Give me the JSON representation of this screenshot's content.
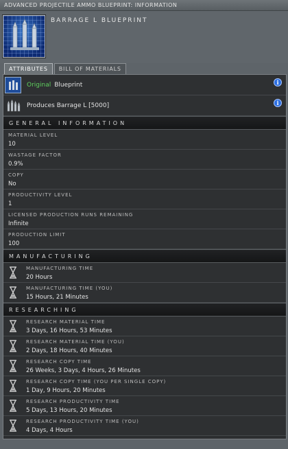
{
  "window": {
    "title": "ADVANCED PROJECTILE AMMO BLUEPRINT: INFORMATION"
  },
  "item": {
    "name": "BARRAGE L BLUEPRINT",
    "icon": "blueprint-icon"
  },
  "tabs": [
    {
      "label": "ATTRIBUTES",
      "active": true
    },
    {
      "label": "BILL OF MATERIALS",
      "active": false
    }
  ],
  "summary": [
    {
      "icon": "blueprint-small-icon",
      "highlight": "Original",
      "text": "Blueprint",
      "info_button": "i"
    },
    {
      "icon": "ammo-icon",
      "text": "Produces Barrage L [5000]",
      "info_button": "i"
    }
  ],
  "general": {
    "header": "GENERAL INFORMATION",
    "props": [
      {
        "label": "MATERIAL LEVEL",
        "value": "10"
      },
      {
        "label": "WASTAGE FACTOR",
        "value": "0.9%"
      },
      {
        "label": "COPY",
        "value": "No"
      },
      {
        "label": "PRODUCTIVITY LEVEL",
        "value": "1"
      },
      {
        "label": "LICENSED PRODUCTION RUNS REMAINING",
        "value": "Infinite"
      },
      {
        "label": "PRODUCTION LIMIT",
        "value": "100"
      }
    ]
  },
  "manufacturing": {
    "header": "MANUFACTURING",
    "rows": [
      {
        "label": "MANUFACTURING TIME",
        "value": "20 Hours"
      },
      {
        "label": "MANUFACTURING TIME (YOU)",
        "value": "15 Hours, 21 Minutes"
      }
    ]
  },
  "researching": {
    "header": "RESEARCHING",
    "rows": [
      {
        "label": "RESEARCH MATERIAL TIME",
        "value": "3 Days, 16 Hours, 53 Minutes"
      },
      {
        "label": "RESEARCH MATERIAL TIME (YOU)",
        "value": "2 Days, 18 Hours, 40 Minutes"
      },
      {
        "label": "RESEARCH COPY TIME",
        "value": "26 Weeks, 3 Days, 4 Hours, 26 Minutes"
      },
      {
        "label": "RESEARCH COPY TIME (YOU PER SINGLE COPY)",
        "value": "1 Day, 9 Hours, 20 Minutes"
      },
      {
        "label": "RESEARCH PRODUCTIVITY TIME",
        "value": "5 Days, 13 Hours, 20 Minutes"
      },
      {
        "label": "RESEARCH PRODUCTIVITY TIME (YOU)",
        "value": "4 Days, 4 Hours"
      }
    ]
  },
  "colors": {
    "highlight_green": "#5fd05f",
    "info_blue": "#2c6ee0",
    "panel_bg": "#2c2e30"
  }
}
